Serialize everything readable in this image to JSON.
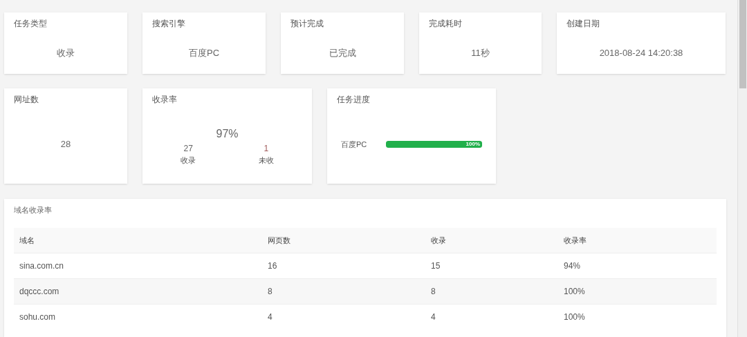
{
  "summary_cards": [
    {
      "title": "任务类型",
      "value": "收录"
    },
    {
      "title": "搜索引擎",
      "value": "百度PC"
    },
    {
      "title": "预计完成",
      "value": "已完成"
    },
    {
      "title": "完成耗时",
      "value": "11秒"
    },
    {
      "title": "创建日期",
      "value": "2018-08-24 14:20:38"
    }
  ],
  "url_count": {
    "title": "网址数",
    "value": "28"
  },
  "index_rate": {
    "title": "收录率",
    "value": "97%",
    "stats": [
      {
        "number": "27",
        "label": "收录"
      },
      {
        "number": "1",
        "label": "未收"
      }
    ]
  },
  "progress": {
    "title": "任务进度",
    "items": [
      {
        "label": "百度PC",
        "level": 1,
        "reading": "100%"
      }
    ]
  },
  "domain_table": {
    "title": "域名收录率",
    "columns": [
      "域名",
      "网页数",
      "收录",
      "收录率"
    ],
    "rows": [
      [
        "sina.com.cn",
        "16",
        "15",
        "94%"
      ],
      [
        "dqccc.com",
        "8",
        "8",
        "100%"
      ],
      [
        "sohu.com",
        "4",
        "4",
        "100%"
      ]
    ]
  }
}
